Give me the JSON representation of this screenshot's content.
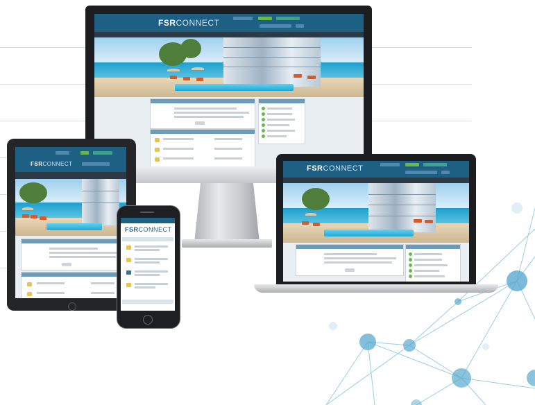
{
  "brand": {
    "logo_bold": "FSR",
    "logo_light": "CONNECT"
  },
  "colors": {
    "brand_blue": "#1e5f84",
    "nav_dark": "#2c3a45",
    "accent_green": "#67b84a",
    "network_blue": "#5aa9cf"
  },
  "devices": {
    "desktop": {
      "icon": "desktop-monitor-icon"
    },
    "tablet": {
      "icon": "tablet-icon"
    },
    "phone": {
      "icon": "smartphone-icon"
    },
    "laptop": {
      "icon": "laptop-icon"
    }
  },
  "decor": {
    "background": "network-graph",
    "lines": "horizontal-rules"
  }
}
